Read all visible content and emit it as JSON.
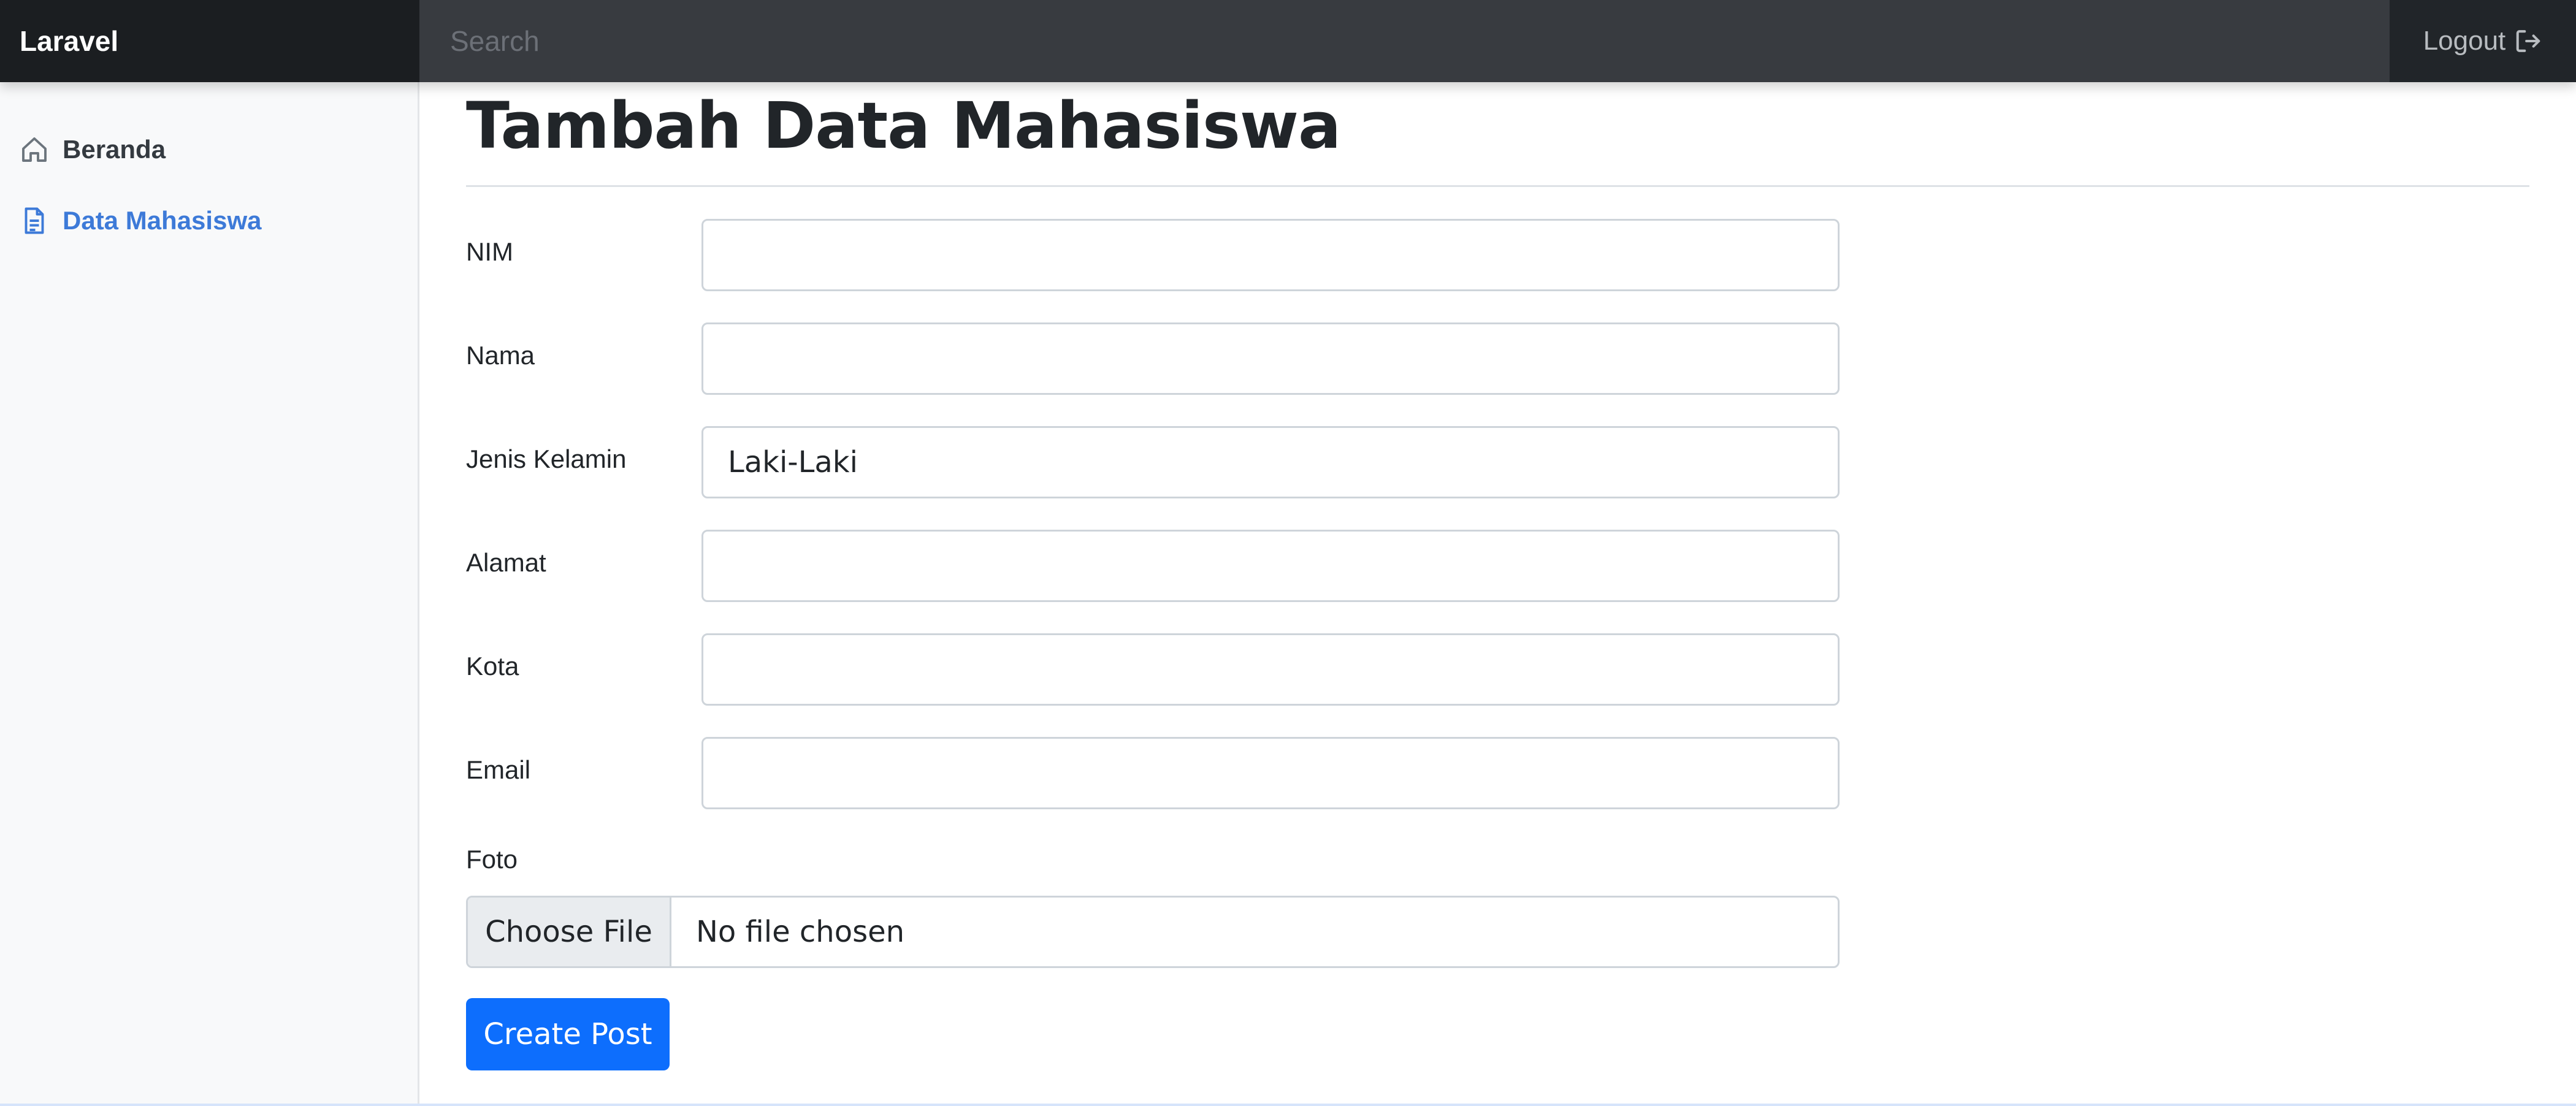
{
  "navbar": {
    "brand": "Laravel",
    "search_placeholder": "Search",
    "logout_label": "Logout",
    "logout_icon": "box-arrow-right-icon"
  },
  "sidebar": {
    "items": [
      {
        "label": "Beranda",
        "icon": "house-icon",
        "active": false
      },
      {
        "label": "Data Mahasiswa",
        "icon": "file-text-icon",
        "active": true
      }
    ]
  },
  "main": {
    "title": "Tambah Data Mahasiswa",
    "fields": [
      {
        "label": "NIM",
        "value": ""
      },
      {
        "label": "Nama",
        "value": ""
      },
      {
        "label": "Jenis Kelamin",
        "value": "Laki-Laki"
      },
      {
        "label": "Alamat",
        "value": ""
      },
      {
        "label": "Kota",
        "value": ""
      },
      {
        "label": "Email",
        "value": ""
      }
    ],
    "photo": {
      "label": "Foto",
      "button_label": "Choose File",
      "status": "No file chosen"
    },
    "submit_label": "Create Post"
  },
  "colors": {
    "navbar_bg": "#212529",
    "active_link": "#3d7ad8",
    "primary_button": "#0d6efd"
  }
}
